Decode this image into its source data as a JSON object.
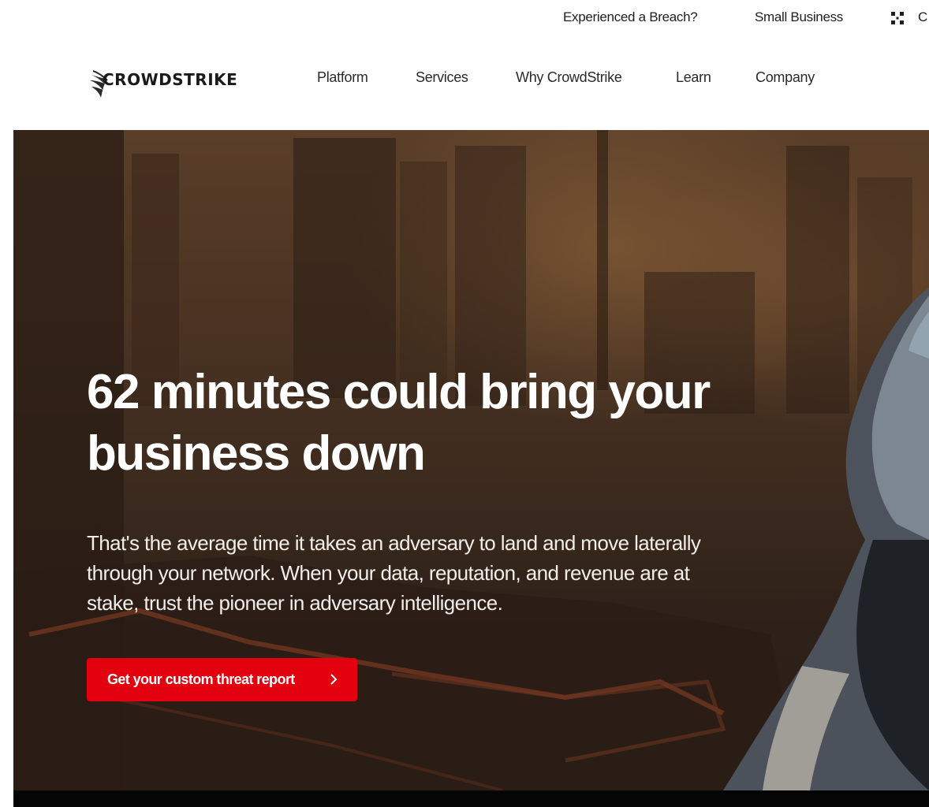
{
  "utility": {
    "breach_link": "Experienced a Breach?",
    "smb_link": "Small Business",
    "apps_cut_text": "C",
    "apps_icon": "grid-icon"
  },
  "nav": {
    "logo_text": "CROWDSTRIKE",
    "logo_icon": "falcon-logo-icon",
    "items": [
      {
        "label": "Platform"
      },
      {
        "label": "Services"
      },
      {
        "label": "Why CrowdStrike"
      },
      {
        "label": "Learn"
      },
      {
        "label": "Company"
      }
    ]
  },
  "hero": {
    "title": "62 minutes could bring your business down",
    "body": "That's the average time it takes an adversary to land and move laterally through your network. When your data, reputation, and revenue are at stake, trust the pioneer in adversary intelligence.",
    "cta_label": "Get your custom threat report",
    "cta_icon": "chevron-right-icon"
  },
  "colors": {
    "accent": "#e3000f",
    "hero_text": "#ffffff",
    "footer_strip": "#050505"
  }
}
